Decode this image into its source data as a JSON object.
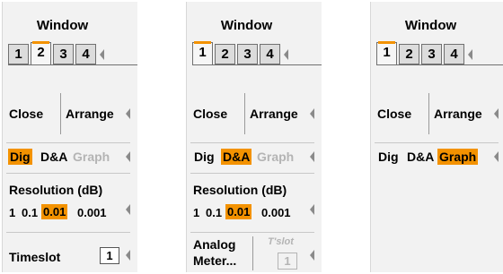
{
  "panels": [
    {
      "title": "Window",
      "tabs": [
        "1",
        "2",
        "3",
        "4"
      ],
      "active_tab": "2",
      "actions": {
        "close": "Close",
        "arrange": "Arrange"
      },
      "modes": {
        "dig": "Dig",
        "da": "D&A",
        "graph": "Graph",
        "selected": "Dig"
      },
      "resolution": {
        "label": "Resolution (dB)",
        "options": [
          "1",
          "0.1",
          "0.01",
          "0.001"
        ],
        "selected": "0.01"
      },
      "timeslot": {
        "label": "Timeslot",
        "value": "1"
      }
    },
    {
      "title": "Window",
      "tabs": [
        "1",
        "2",
        "3",
        "4"
      ],
      "active_tab": "1",
      "actions": {
        "close": "Close",
        "arrange": "Arrange"
      },
      "modes": {
        "dig": "Dig",
        "da": "D&A",
        "graph": "Graph",
        "selected": "D&A"
      },
      "resolution": {
        "label": "Resolution (dB)",
        "options": [
          "1",
          "0.1",
          "0.01",
          "0.001"
        ],
        "selected": "0.01"
      },
      "analog_meter": {
        "line1": "Analog",
        "line2": "Meter..."
      },
      "tslot": {
        "label": "T'slot",
        "value": "1"
      }
    },
    {
      "title": "Window",
      "tabs": [
        "1",
        "2",
        "3",
        "4"
      ],
      "active_tab": "1",
      "actions": {
        "close": "Close",
        "arrange": "Arrange"
      },
      "modes": {
        "dig": "Dig",
        "da": "D&A",
        "graph": "Graph",
        "selected": "Graph"
      }
    }
  ],
  "colors": {
    "highlight": "#f39200",
    "panel_bg": "#f2f2f2",
    "disabled_text": "#b4b4b4"
  }
}
